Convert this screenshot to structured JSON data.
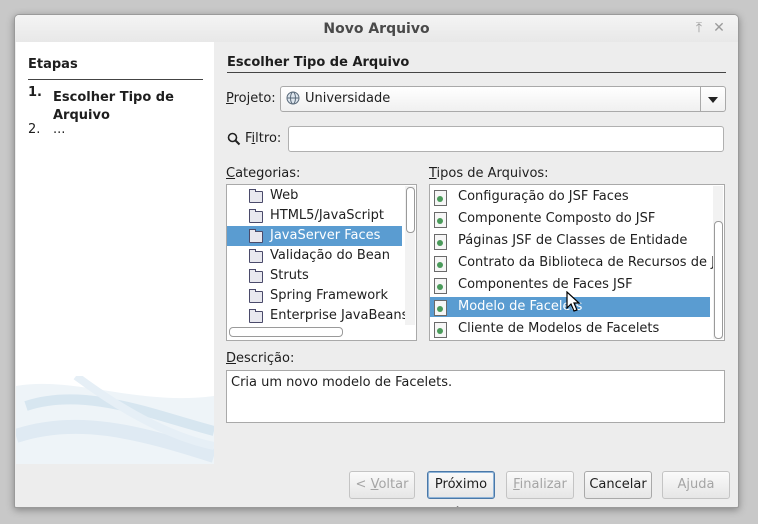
{
  "window": {
    "title": "Novo Arquivo",
    "pin_icon": "pin-icon",
    "close_icon": "close-icon"
  },
  "steps": {
    "title": "Etapas",
    "items": [
      {
        "num": "1.",
        "label": "Escolher Tipo de Arquivo",
        "current": true
      },
      {
        "num": "2.",
        "label": "..."
      }
    ]
  },
  "main": {
    "title": "Escolher Tipo de Arquivo",
    "project_label_u": "P",
    "project_label_rest": "rojeto:",
    "project_value": "Universidade",
    "filter_label_u": "i",
    "filter_label_pre": "F",
    "filter_label_rest": "ltro:",
    "filter_value": "",
    "categories_label_u": "C",
    "categories_label_rest": "ategorias:",
    "types_label_u": "T",
    "types_label_rest": "ipos de Arquivos:",
    "categories": [
      "Web",
      "HTML5/JavaScript",
      "JavaServer Faces",
      "Validação do Bean",
      "Struts",
      "Spring Framework",
      "Enterprise JavaBeans"
    ],
    "selected_category": "JavaServer Faces",
    "file_types": [
      "Configuração do JSF Faces",
      "Componente Composto do JSF",
      "Páginas JSF de Classes de Entidade",
      "Contrato da Biblioteca de Recursos de JSF",
      "Componentes de Faces JSF",
      "Modelo de Facelets",
      "Cliente de Modelos de Facelets"
    ],
    "selected_type": "Modelo de Facelets",
    "description_label_u": "D",
    "description_label_rest": "escrição:",
    "description": "Cria um novo modelo de Facelets."
  },
  "buttons": {
    "back_pre": "< ",
    "back_u": "V",
    "back_rest": "oltar",
    "next": "Próximo >",
    "finish_u": "F",
    "finish_rest": "inalizar",
    "cancel": "Cancelar",
    "help": "Ajuda"
  },
  "colors": {
    "selection": "#5a9cd1",
    "window_bg": "#ededed"
  }
}
